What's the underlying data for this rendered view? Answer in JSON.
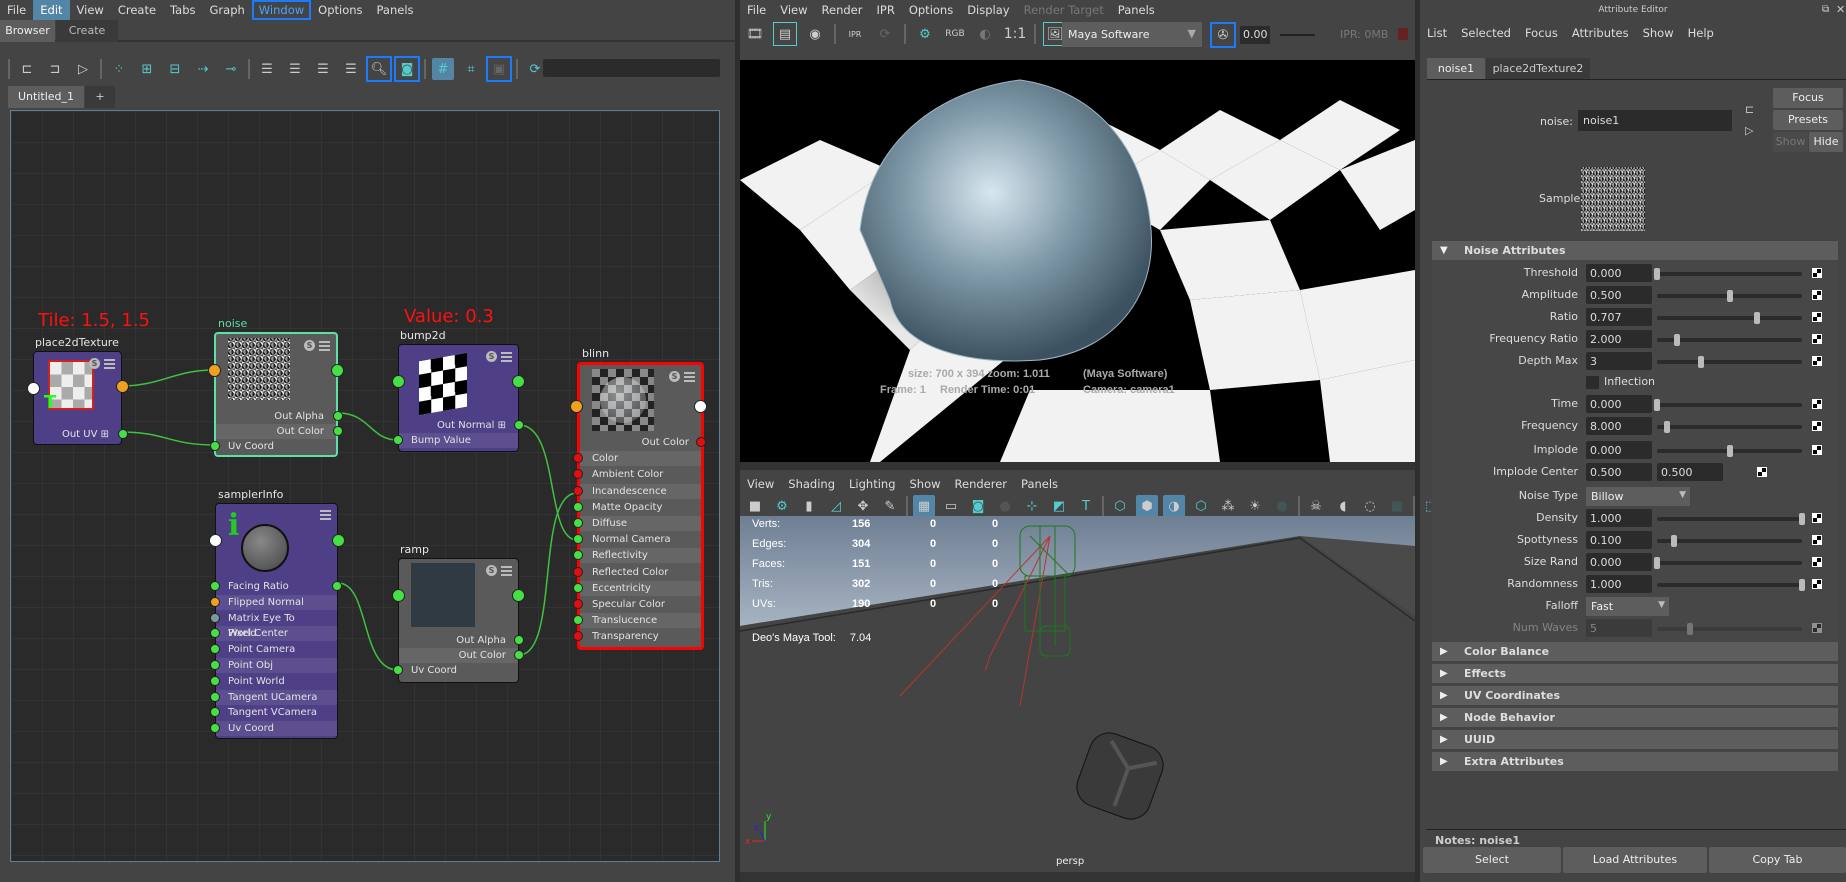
{
  "hypershade": {
    "menu": [
      "File",
      "Edit",
      "View",
      "Create",
      "Tabs",
      "Graph",
      "Window",
      "Options",
      "Panels"
    ],
    "tabs": [
      "Browser",
      "Create"
    ],
    "doc_tabs": [
      "Untitled_1",
      "+"
    ],
    "annotations": {
      "tile": "Tile: 1.5, 1.5",
      "value": "Value: 0.3"
    },
    "nodes": {
      "place2d": {
        "title": "place2dTexture",
        "rows": [
          "Out UV"
        ]
      },
      "noise": {
        "title": "noise",
        "rows": [
          "Out Alpha",
          "Out Color",
          "Uv Coord"
        ]
      },
      "bump": {
        "title": "bump2d",
        "rows": [
          "Out Normal",
          "Bump Value"
        ]
      },
      "blinn": {
        "title": "blinn",
        "rows": [
          "Out Color",
          "Color",
          "Ambient Color",
          "Incandescence",
          "Matte Opacity",
          "Diffuse",
          "Normal Camera",
          "Reflectivity",
          "Reflected Color",
          "Eccentricity",
          "Specular Color",
          "Translucence",
          "Transparency"
        ]
      },
      "sampler": {
        "title": "samplerInfo",
        "rows": [
          "Facing Ratio",
          "Flipped Normal",
          "Matrix Eye To World",
          "Pixel Center",
          "Point Camera",
          "Point Obj",
          "Point World",
          "Tangent UCamera",
          "Tangent VCamera",
          "Uv Coord"
        ]
      },
      "ramp": {
        "title": "ramp",
        "rows": [
          "Out Alpha",
          "Out Color",
          "Uv Coord"
        ]
      }
    },
    "port_colors": {
      "green": "#45e045",
      "orange": "#f0a020",
      "red": "#e01010",
      "white": "#ffffff",
      "grey": "#7a9aa0"
    }
  },
  "render_view": {
    "menu": [
      "File",
      "View",
      "Render",
      "IPR",
      "Options",
      "Display",
      "Render Target",
      "Panels"
    ],
    "toolbar": {
      "rgb": "RGB",
      "ratio": "1:1",
      "renderer": "Maya Software",
      "exposure": "0.00",
      "ipr": "IPR: 0MB"
    },
    "info": {
      "line1": "size: 700 x 394 zoom: 1.011",
      "line1b": "(Maya Software)",
      "line2a": "Frame: 1",
      "line2b": "Render Time: 0:01",
      "line2c": "Camera: camera1"
    }
  },
  "viewport": {
    "menu": [
      "View",
      "Shading",
      "Lighting",
      "Show",
      "Renderer",
      "Panels"
    ],
    "stats": [
      [
        "Verts:",
        "156",
        "0",
        "0"
      ],
      [
        "Edges:",
        "304",
        "0",
        "0"
      ],
      [
        "Faces:",
        "151",
        "0",
        "0"
      ],
      [
        "Tris:",
        "302",
        "0",
        "0"
      ],
      [
        "UVs:",
        "190",
        "0",
        "0"
      ]
    ],
    "tool_label": "Deo's Maya Tool:",
    "tool_value": "7.04",
    "camera": "persp",
    "exposure_partial": "0."
  },
  "attribute_editor": {
    "title": "Attribute Editor",
    "menu": [
      "List",
      "Selected",
      "Focus",
      "Attributes",
      "Show",
      "Help"
    ],
    "tabs": [
      "noise1",
      "place2dTexture2"
    ],
    "node_label": "noise:",
    "node_value": "noise1",
    "buttons": {
      "focus": "Focus",
      "presets": "Presets",
      "show": "Show",
      "hide": "Hide"
    },
    "sample_label": "Sample",
    "section": "Noise Attributes",
    "attrs": [
      {
        "label": "Threshold",
        "value": "0.000",
        "slider": 0.0
      },
      {
        "label": "Amplitude",
        "value": "0.500",
        "slider": 0.5
      },
      {
        "label": "Ratio",
        "value": "0.707",
        "slider": 0.69
      },
      {
        "label": "Frequency Ratio",
        "value": "2.000",
        "slider": 0.14
      },
      {
        "label": "Depth Max",
        "value": "3",
        "slider": 0.3
      },
      {
        "label": "Inflection",
        "checkbox": false
      },
      {
        "label": "Time",
        "value": "0.000",
        "slider": 0.0
      },
      {
        "label": "Frequency",
        "value": "8.000",
        "slider": 0.07
      },
      {
        "label": "Implode",
        "value": "0.000",
        "slider": 0.5
      },
      {
        "label": "Implode Center",
        "value": "0.500",
        "value2": "0.500"
      },
      {
        "label": "Noise Type",
        "option": "Billow"
      },
      {
        "label": "Density",
        "value": "1.000",
        "slider": 1.0
      },
      {
        "label": "Spottyness",
        "value": "0.100",
        "slider": 0.12
      },
      {
        "label": "Size Rand",
        "value": "0.000",
        "slider": 0.0
      },
      {
        "label": "Randomness",
        "value": "1.000",
        "slider": 1.0
      },
      {
        "label": "Falloff",
        "option": "Fast"
      },
      {
        "label": "Num Waves",
        "value": "5",
        "slider": 0.23,
        "disabled": true
      }
    ],
    "sections": [
      "Color Balance",
      "Effects",
      "UV Coordinates",
      "Node Behavior",
      "UUID",
      "Extra Attributes"
    ],
    "notes": "Notes: noise1",
    "bottom_buttons": [
      "Select",
      "Load Attributes",
      "Copy Tab"
    ]
  }
}
